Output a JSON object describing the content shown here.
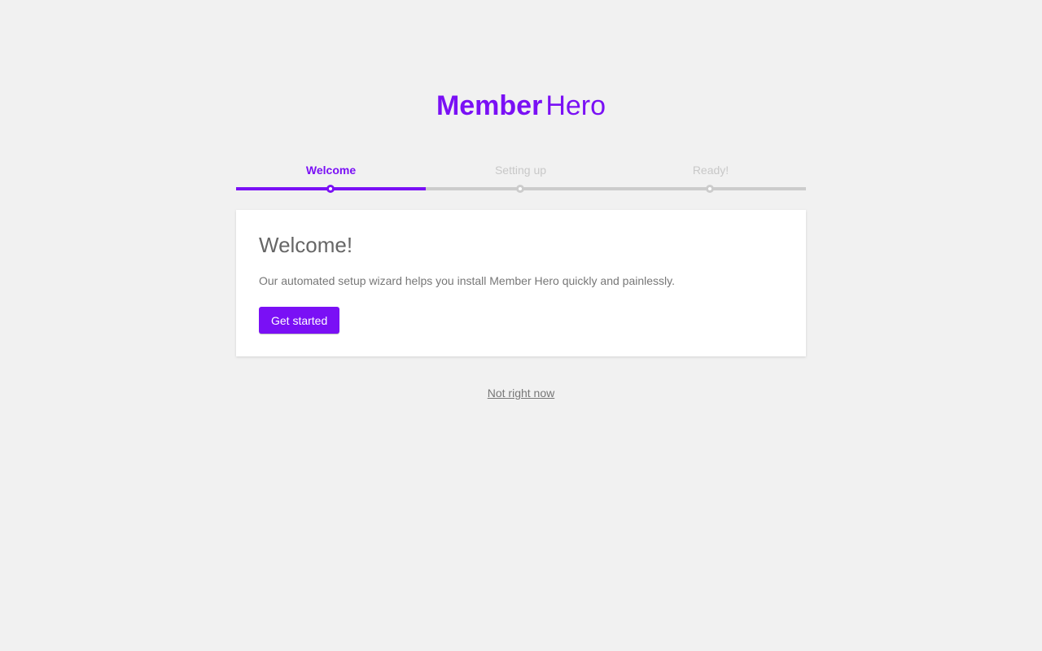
{
  "brand": {
    "name_bold": "Member",
    "name_light": "Hero",
    "accent_color": "#7a10f5"
  },
  "steps": [
    {
      "label": "Welcome",
      "state": "active"
    },
    {
      "label": "Setting up",
      "state": "pending"
    },
    {
      "label": "Ready!",
      "state": "pending"
    }
  ],
  "card": {
    "title": "Welcome!",
    "text": "Our automated setup wizard helps you install Member Hero quickly and painlessly.",
    "button_label": "Get started"
  },
  "skip_link": "Not right now"
}
